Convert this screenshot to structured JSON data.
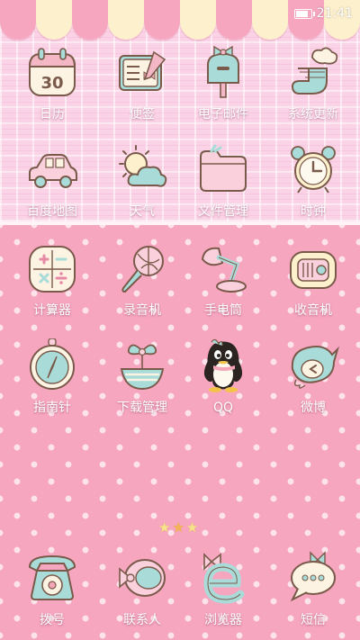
{
  "status_bar": {
    "time": "21:41",
    "battery_icon": "battery-full-icon"
  },
  "apps_row1": [
    {
      "label": "日历",
      "icon": "calendar-icon",
      "calendar_day": "30"
    },
    {
      "label": "便签",
      "icon": "notepad-icon"
    },
    {
      "label": "电子邮件",
      "icon": "mailbox-icon"
    },
    {
      "label": "系统更新",
      "icon": "cloud-sock-update-icon"
    }
  ],
  "apps_row2": [
    {
      "label": "百度地图",
      "icon": "car-map-icon"
    },
    {
      "label": "天气",
      "icon": "sun-cloud-weather-icon"
    },
    {
      "label": "文件管理",
      "icon": "folder-icon"
    },
    {
      "label": "时钟",
      "icon": "alarm-clock-icon"
    }
  ],
  "apps_row3": [
    {
      "label": "计算器",
      "icon": "calculator-icon"
    },
    {
      "label": "录音机",
      "icon": "microphone-icon"
    },
    {
      "label": "手电筒",
      "icon": "desk-lamp-icon"
    },
    {
      "label": "收音机",
      "icon": "radio-icon"
    }
  ],
  "apps_row4": [
    {
      "label": "指南针",
      "icon": "compass-icon"
    },
    {
      "label": "下载管理",
      "icon": "download-basket-icon"
    },
    {
      "label": "QQ",
      "icon": "qq-penguin-icon"
    },
    {
      "label": "微博",
      "icon": "weibo-bird-icon"
    }
  ],
  "dock": [
    {
      "label": "拨号",
      "icon": "rotary-phone-icon"
    },
    {
      "label": "联系人",
      "icon": "contacts-bow-icon"
    },
    {
      "label": "浏览器",
      "icon": "browser-e-icon"
    },
    {
      "label": "短信",
      "icon": "message-bubble-icon"
    }
  ],
  "pager": {
    "total_pages": 3,
    "current_page": 2
  },
  "colors": {
    "pink_bg": "#f7a6bf",
    "plaid_bg": "#fbd3e6",
    "awning_cream": "#fdf0cc",
    "icon_mint": "#a9dcd8",
    "icon_cream": "#fdf3e3",
    "icon_outline": "#7a5a4a"
  }
}
